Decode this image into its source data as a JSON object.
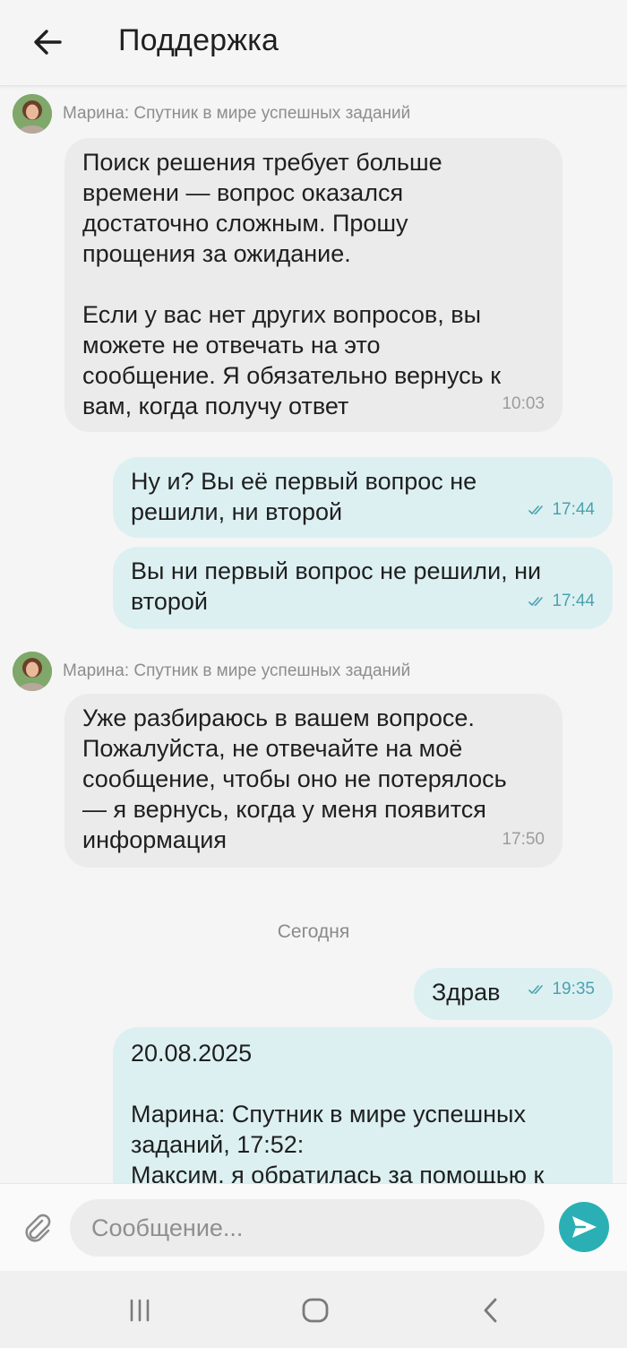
{
  "header": {
    "title": "Поддержка"
  },
  "messages": [
    {
      "type": "incoming",
      "sender": "Марина: Спутник в мире успешных заданий",
      "text": "Поиск решения требует больше\nвремени — вопрос оказался\nдостаточно сложным. Прошу\nпрощения за ожидание.\n\nЕсли у вас нет других вопросов, вы\nможете не отвечать на это\nсообщение. Я обязательно вернусь к\nвам, когда получу ответ",
      "time": "10:03"
    },
    {
      "type": "outgoing",
      "text": "Ну и? Вы её первый вопрос не\nрешили, ни второй",
      "time": "17:44"
    },
    {
      "type": "outgoing",
      "text": "Вы ни первый вопрос не решили, ни\nвторой",
      "time": "17:44"
    },
    {
      "type": "incoming",
      "sender": "Марина: Спутник в мире успешных заданий",
      "text": "Уже разбираюсь в вашем вопросе.\nПожалуйста, не отвечайте на моё\nсообщение, чтобы оно не потерялось\n— я вернусь, когда у меня появится\nинформация",
      "time": "17:50"
    },
    {
      "type": "date",
      "text": "Сегодня"
    },
    {
      "type": "outgoing",
      "text": "Здрав",
      "time": "19:35"
    },
    {
      "type": "outgoing",
      "text": "20.08.2025\n\nМарина: Спутник в мире успешных\nзаданий, 17:52:\nМаксим, я обратилась за помощью к"
    }
  ],
  "composer": {
    "placeholder": "Сообщение..."
  },
  "colors": {
    "accent": "#2ab0b4",
    "outgoing_bubble": "#dcf0f2",
    "incoming_bubble": "#ebebeb"
  },
  "icons": {
    "back": "arrow-left-icon",
    "attach": "paperclip-icon",
    "send": "send-icon",
    "read": "double-check-icon",
    "nav": [
      "recent-apps-icon",
      "home-icon",
      "back-nav-icon"
    ]
  }
}
